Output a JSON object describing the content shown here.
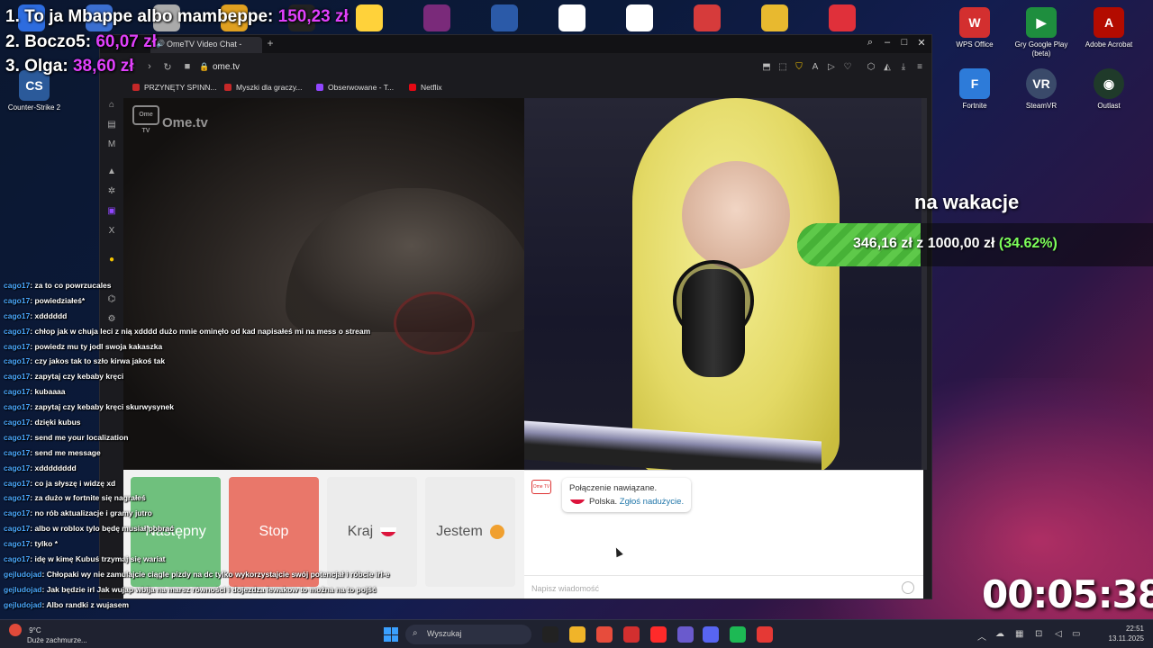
{
  "leaderboard": [
    {
      "rank_name": "1. To ja Mbappe albo mambeppe:",
      "amount": "150,23 zł"
    },
    {
      "rank_name": "2. Boczo5:",
      "amount": "60,07 zł"
    },
    {
      "rank_name": "3. Olga:",
      "amount": "38,60 zł"
    }
  ],
  "desktop_icons": [
    {
      "label": "Counter-Strike 2",
      "icon": "cs2-icon",
      "color": "#2b5a9a"
    },
    {
      "label": "WPS Office",
      "icon": "wps-office-icon",
      "color": "#d32f2f"
    },
    {
      "label": "Gry Google Play (beta)",
      "icon": "google-play-games-icon",
      "color": "#1e8e3e"
    },
    {
      "label": "Adobe Acrobat",
      "icon": "adobe-acrobat-icon",
      "color": "#b30b00"
    },
    {
      "label": "Fortnite",
      "icon": "fortnite-icon",
      "color": "#2d7bd9"
    },
    {
      "label": "SteamVR",
      "icon": "steamvr-icon",
      "color": "#3a4a6a"
    },
    {
      "label": "Outlast",
      "icon": "outlast-icon",
      "color": "#1f3a2a"
    }
  ],
  "top_icons_colors": [
    "#2d6cdf",
    "#3b6fd1",
    "#aaaaaa",
    "#e0a020",
    "#222222",
    "#ffd23a",
    "#7a2a7a",
    "#2b5aa8",
    "#ffffff",
    "#ffffff",
    "#d63b3b",
    "#e8b92f",
    "#e0303a"
  ],
  "browser": {
    "tab_title": "OmeTV Video Chat -",
    "url": "ome.tv",
    "bookmarks": [
      {
        "label": "PRZYNĘTY SPINN...",
        "color": "#c62828"
      },
      {
        "label": "Myszki dla graczy...",
        "color": "#c62828"
      },
      {
        "label": "Obserwowane - T...",
        "color": "#9146ff"
      },
      {
        "label": "Netflix",
        "color": "#e50914"
      }
    ]
  },
  "ometv": {
    "logo": "Ome.tv",
    "logo_badge": "Ome TV",
    "buttons": {
      "next": "Następny",
      "stop": "Stop",
      "country": "Kraj",
      "me": "Jestem"
    },
    "chat": {
      "avatar": "Ome TV",
      "status": "Połączenie nawiązane.",
      "country": "Polska.",
      "report": "Zgłoś nadużycie.",
      "placeholder": "Napisz wiadomość"
    }
  },
  "stream_chat": [
    {
      "user": "cago17",
      "text": ": za to co powrzucales"
    },
    {
      "user": "cago17",
      "text": ": powiedziałeś*"
    },
    {
      "user": "cago17",
      "text": ": xdddddd"
    },
    {
      "user": "cago17",
      "text": ": chłop jak w chuja leci z nią xdddd dużo mnie ominęło od kad napisałeś mi na mess o stream"
    },
    {
      "user": "cago17",
      "text": ": powiedz mu ty jodl swoja kakaszka"
    },
    {
      "user": "cago17",
      "text": ": czy jakos tak to szło kirwa jakoś tak"
    },
    {
      "user": "cago17",
      "text": ": zapytaj czy kebaby kręci"
    },
    {
      "user": "cago17",
      "text": ": kubaaaa"
    },
    {
      "user": "cago17",
      "text": ": zapytaj czy kebaby kręci skurwysynek"
    },
    {
      "user": "cago17",
      "text": ": dzięki kubus"
    },
    {
      "user": "cago17",
      "text": ": send me your localization"
    },
    {
      "user": "cago17",
      "text": ": send me message"
    },
    {
      "user": "cago17",
      "text": ": xdddddddd"
    },
    {
      "user": "cago17",
      "text": ": co ja słyszę i widzę xd"
    },
    {
      "user": "cago17",
      "text": ": za dużo w fortnite się nagrałeś"
    },
    {
      "user": "cago17",
      "text": ": no rób aktualizacje i gramy jutro"
    },
    {
      "user": "cago17",
      "text": ": albo w roblox tylo będę musiał pobrać"
    },
    {
      "user": "cago17",
      "text": ": tylko *"
    },
    {
      "user": "cago17",
      "text": ": idę w kimę Kubuś trzymaj się wariat"
    },
    {
      "user": "gejludojad",
      "text": ": Chłopaki wy nie zamulajcie ciągle pizdy na dc tylko wykorzystajcie swój potencjał i róbcie irl-e"
    },
    {
      "user": "gejludojad",
      "text": ": Jak będzie irl Jak wujap wbija na marsz równości i dojezdza lewakow to można na to pojść"
    },
    {
      "user": "gejludojad",
      "text": ": Albo randki z wujasem"
    }
  ],
  "goal": {
    "title": "na wakacje",
    "current": "346,16 zł",
    "separator": "z",
    "target": "1000,00 zł",
    "percent_label": "(34.62%)",
    "progress": 0.3462
  },
  "timer": "00:05:38",
  "taskbar": {
    "weather_temp": "9°C",
    "weather_desc": "Duże zachmurze...",
    "search_placeholder": "Wyszukaj",
    "time": "22:51",
    "date": "13.11.2025",
    "apps_colors": [
      "#222222",
      "#f0b429",
      "#e74c3c",
      "#d32f2f",
      "#ff2a2a",
      "#6a5acd",
      "#5865f2",
      "#1db954",
      "#e53935"
    ]
  }
}
